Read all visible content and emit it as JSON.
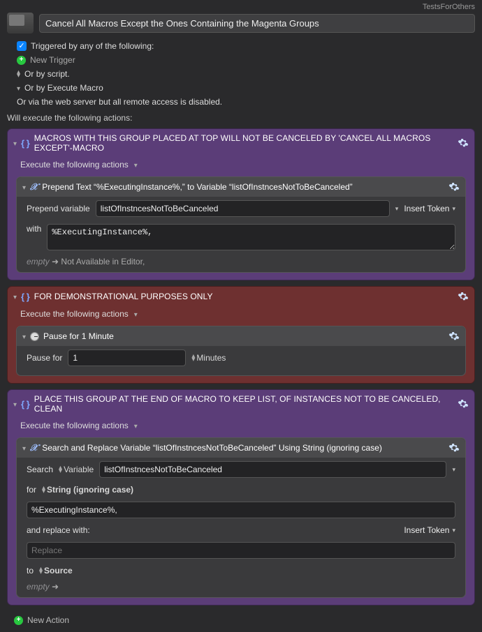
{
  "topbar": {
    "breadcrumb": "TestsForOthers"
  },
  "macro": {
    "title": "Cancel All Macros Except the Ones Containing the Magenta Groups",
    "trigger_section": {
      "triggered_by": "Triggered by any of the following:",
      "new_trigger": "New Trigger",
      "by_script": "Or by script.",
      "by_execute_macro": "Or by Execute Macro",
      "via_web": "Or via the web server but all remote access is disabled."
    },
    "actions_label": "Will execute the following actions:"
  },
  "groups": [
    {
      "color": "purple",
      "title": "MACROS WITH THIS GROUP PLACED AT TOP WILL NOT BE CANCELED BY 'CANCEL ALL MACROS EXCEPT'-MACRO",
      "exec_label": "Execute the following actions",
      "action": {
        "type": "prepend",
        "title": "Prepend Text “%ExecutingInstance%,” to Variable “listOfInstncesNotToBeCanceled”",
        "prepend_label": "Prepend variable",
        "variable": "listOfInstncesNotToBeCanceled",
        "insert_token": "Insert Token",
        "with_label": "with",
        "with_value": "%ExecutingInstance%,",
        "empty_word": "empty",
        "not_available": "Not Available in Editor,"
      }
    },
    {
      "color": "red",
      "title": "FOR DEMONSTRATIONAL PURPOSES ONLY",
      "exec_label": "Execute the following actions",
      "action": {
        "type": "pause",
        "title": "Pause for 1 Minute",
        "pause_label": "Pause for",
        "pause_value": "1",
        "unit": "Minutes"
      }
    },
    {
      "color": "purple",
      "title": "PLACE THIS GROUP AT THE END OF MACRO TO KEEP LIST, OF INSTANCES NOT TO BE CANCELED, CLEAN",
      "exec_label": "Execute the following actions",
      "action": {
        "type": "search",
        "title": "Search and Replace Variable “listOfInstncesNotToBeCanceled” Using String (ignoring case)",
        "search_label": "Search",
        "variable_label": "Variable",
        "variable": "listOfInstncesNotToBeCanceled",
        "for_label": "for",
        "for_mode": "String (ignoring case)",
        "for_value": "%ExecutingInstance%,",
        "replace_label": "and replace with:",
        "insert_token": "Insert Token",
        "replace_placeholder": "Replace",
        "to_label": "to",
        "to_target": "Source",
        "empty_word": "empty"
      }
    }
  ],
  "footer": {
    "new_action": "New Action"
  }
}
